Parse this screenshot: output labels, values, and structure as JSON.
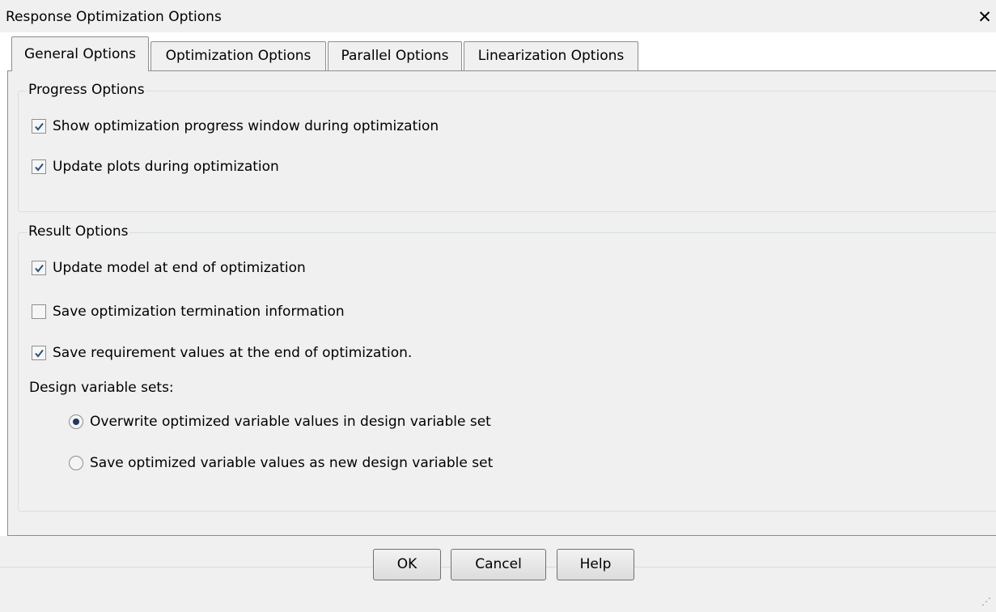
{
  "window": {
    "title": "Response Optimization Options",
    "close_glyph": "✕"
  },
  "tabs": [
    {
      "label": "General Options",
      "active": true
    },
    {
      "label": "Optimization Options",
      "active": false
    },
    {
      "label": "Parallel Options",
      "active": false
    },
    {
      "label": "Linearization Options",
      "active": false
    }
  ],
  "progress_options": {
    "label": "Progress Options",
    "items": [
      {
        "label": "Show optimization progress window during optimization",
        "checked": true
      },
      {
        "label": "Update plots during optimization",
        "checked": true
      }
    ]
  },
  "result_options": {
    "label": "Result Options",
    "items": [
      {
        "label": "Update model at end of optimization",
        "checked": true
      },
      {
        "label": "Save optimization termination information",
        "checked": false
      },
      {
        "label": "Save requirement values at the end of optimization.",
        "checked": true
      }
    ],
    "design_sets_label": "Design variable sets:",
    "radios": [
      {
        "label": "Overwrite optimized variable values in design variable set",
        "selected": true
      },
      {
        "label": "Save optimized variable values as new design variable set",
        "selected": false
      }
    ]
  },
  "buttons": {
    "ok": "OK",
    "cancel": "Cancel",
    "help": "Help"
  },
  "icons": {
    "close": "close-icon",
    "checkbox_checked": "checkmark-icon",
    "resize_grip": "resize-grip-icon"
  },
  "colors": {
    "check_mark": "#2a4f7a",
    "radio_dot": "#1f3a5a"
  }
}
